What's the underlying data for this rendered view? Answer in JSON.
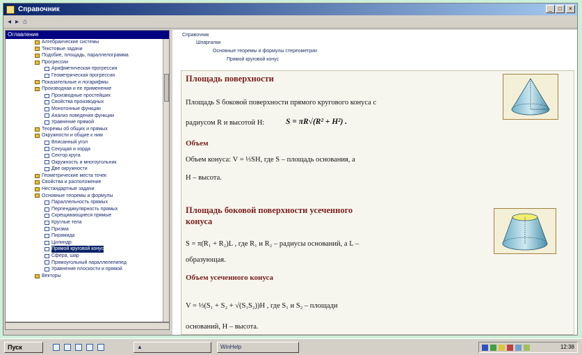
{
  "window": {
    "title": "Справочник"
  },
  "toolbar": {
    "back": "◂",
    "forward": "▸",
    "home": "⌂"
  },
  "left_pane": {
    "header": "Оглавление",
    "tree": [
      {
        "label": "Алгебраические системы",
        "level": 0,
        "type": "folder"
      },
      {
        "label": "Текстовые задачи",
        "level": 0,
        "type": "folder"
      },
      {
        "label": "Подобие, площадь, параллелограмма",
        "level": 0,
        "type": "folder"
      },
      {
        "label": "Прогрессии",
        "level": 0,
        "type": "folder"
      },
      {
        "label": "Арифметическая прогрессия",
        "level": 1,
        "type": "page"
      },
      {
        "label": "Геометрическая прогрессия",
        "level": 1,
        "type": "page"
      },
      {
        "label": "Показательные и логарифмы",
        "level": 0,
        "type": "folder"
      },
      {
        "label": "Производная и ее применение",
        "level": 0,
        "type": "folder"
      },
      {
        "label": "Производные простейших",
        "level": 1,
        "type": "page"
      },
      {
        "label": "Свойства производных",
        "level": 1,
        "type": "page"
      },
      {
        "label": "Монотонные функции",
        "level": 1,
        "type": "page"
      },
      {
        "label": "Анализ поведения функции",
        "level": 1,
        "type": "page"
      },
      {
        "label": "Уравнение прямой",
        "level": 1,
        "type": "page"
      },
      {
        "label": "Теоремы об общих и прямых",
        "level": 0,
        "type": "folder"
      },
      {
        "label": "Окружности и общие к ним",
        "level": 0,
        "type": "folder"
      },
      {
        "label": "Вписанный угол",
        "level": 1,
        "type": "page"
      },
      {
        "label": "Секущая и хорда",
        "level": 1,
        "type": "page"
      },
      {
        "label": "Сектор круга",
        "level": 1,
        "type": "page"
      },
      {
        "label": "Окружность и многоугольник",
        "level": 1,
        "type": "page"
      },
      {
        "label": "Две окружности",
        "level": 1,
        "type": "page"
      },
      {
        "label": "Геометрические места точек",
        "level": 0,
        "type": "folder"
      },
      {
        "label": "Свойства и расположение",
        "level": 0,
        "type": "folder"
      },
      {
        "label": "Нестандартные задачи",
        "level": 0,
        "type": "folder"
      },
      {
        "label": "Основные теоремы и формулы",
        "level": 0,
        "type": "folder"
      },
      {
        "label": "Параллельность прямых",
        "level": 1,
        "type": "page"
      },
      {
        "label": "Перпендикулярность прямых",
        "level": 1,
        "type": "page"
      },
      {
        "label": "Скрещивающиеся прямые",
        "level": 1,
        "type": "page"
      },
      {
        "label": "Круглые тела",
        "level": 1,
        "type": "page"
      },
      {
        "label": "Призма",
        "level": 1,
        "type": "page"
      },
      {
        "label": "Пирамида",
        "level": 1,
        "type": "page"
      },
      {
        "label": "Цилиндр",
        "level": 1,
        "type": "page"
      },
      {
        "label": "Прямой круговой конус",
        "level": 1,
        "type": "page",
        "selected": true
      },
      {
        "label": "Сфера, шар",
        "level": 1,
        "type": "page"
      },
      {
        "label": "Прямоугольный параллелепипед",
        "level": 1,
        "type": "page"
      },
      {
        "label": "Уравнение плоскости и прямой",
        "level": 1,
        "type": "page"
      },
      {
        "label": "Векторы",
        "level": 0,
        "type": "folder"
      }
    ]
  },
  "breadcrumb": {
    "lines": [
      "Справочник",
      "Шпаргалки",
      "Основные теоремы и формулы стереометрии",
      "Прямой круговой конус"
    ]
  },
  "content": {
    "s1_heading": "Площадь поверхности",
    "s1_line1": "Площадь S боковой поверхности прямого кругового конуса с",
    "s1_line2": "радиусом R и высотой H:",
    "s1_formula": "S = πR√(R² + H²) .",
    "s2_heading": "Объем",
    "s2_line1": "Объем конуса: V = ⅓SH, где S – площадь основания, а",
    "s2_line2": "H – высота.",
    "s3_heading_1": "Площадь боковой поверхности усеченного",
    "s3_heading_2": "конуса",
    "s3_line1": "S = π(R₁ + R₂)L , где R₁ и R₂ – радиусы оснований, а L –",
    "s3_line2": "образующая.",
    "s4_heading": "Объем усеченного конуса",
    "s4_line1": "V = ⅓(S₁ + S₂ + √(S₁S₂))H , где S₁ и S₂ – площади",
    "s4_line2": "оснований, H – высота."
  },
  "taskbar": {
    "start": "Пуск",
    "task_label": "WinHelp",
    "clock": "12:38"
  }
}
